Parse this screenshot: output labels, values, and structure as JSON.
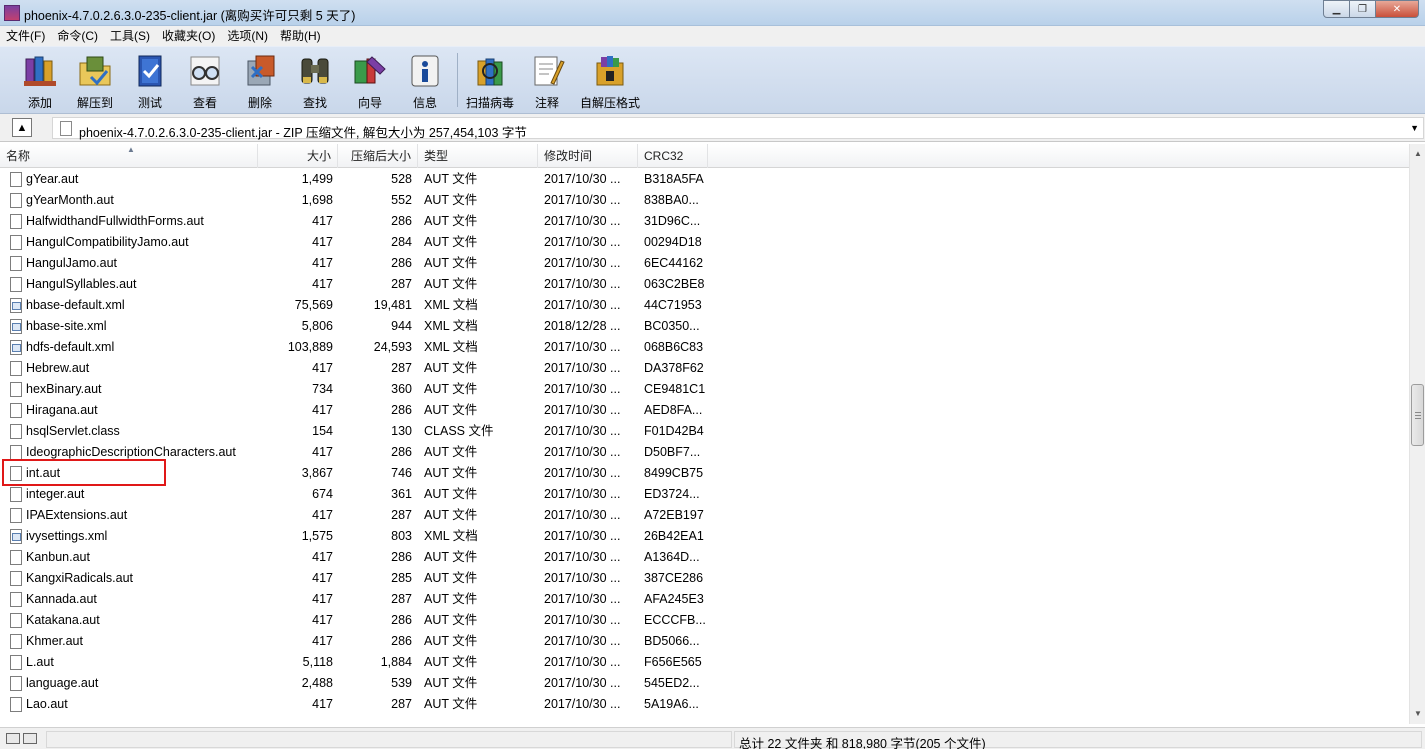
{
  "window": {
    "title": "phoenix-4.7.0.2.6.3.0-235-client.jar (离购买许可只剩 5 天了)",
    "min_glyph": "▁",
    "max_glyph": "❐",
    "close_glyph": "✕"
  },
  "menu": [
    {
      "label": "文件(F)"
    },
    {
      "label": "命令(C)"
    },
    {
      "label": "工具(S)"
    },
    {
      "label": "收藏夹(O)"
    },
    {
      "label": "选项(N)"
    },
    {
      "label": "帮助(H)"
    }
  ],
  "toolbar": [
    {
      "label": "添加",
      "icon": "add-books-icon"
    },
    {
      "label": "解压到",
      "icon": "extract-folder-icon"
    },
    {
      "label": "测试",
      "icon": "test-book-icon"
    },
    {
      "label": "查看",
      "icon": "view-glasses-icon"
    },
    {
      "label": "删除",
      "icon": "delete-icon"
    },
    {
      "label": "查找",
      "icon": "binoculars-icon"
    },
    {
      "label": "向导",
      "icon": "wizard-icon"
    },
    {
      "label": "信息",
      "icon": "info-icon"
    },
    {
      "label": "扫描病毒",
      "icon": "virus-scan-icon"
    },
    {
      "label": "注释",
      "icon": "comment-icon"
    },
    {
      "label": "自解压格式",
      "icon": "sfx-icon"
    }
  ],
  "address": {
    "up_glyph": "▲",
    "path": "phoenix-4.7.0.2.6.3.0-235-client.jar - ZIP 压缩文件, 解包大小为 257,454,103 字节",
    "dropdown_glyph": "▼"
  },
  "columns": {
    "name": "名称",
    "size": "大小",
    "packed": "压缩后大小",
    "type": "类型",
    "modified": "修改时间",
    "crc": "CRC32",
    "sort_glyph": "▲"
  },
  "files": [
    {
      "name": "gYear.aut",
      "size": "1,499",
      "packed": "528",
      "type": "AUT 文件",
      "modified": "2017/10/30 ...",
      "crc": "B318A5FA",
      "icon": "file-icon"
    },
    {
      "name": "gYearMonth.aut",
      "size": "1,698",
      "packed": "552",
      "type": "AUT 文件",
      "modified": "2017/10/30 ...",
      "crc": "838BA0...",
      "icon": "file-icon"
    },
    {
      "name": "HalfwidthandFullwidthForms.aut",
      "size": "417",
      "packed": "286",
      "type": "AUT 文件",
      "modified": "2017/10/30 ...",
      "crc": "31D96C...",
      "icon": "file-icon"
    },
    {
      "name": "HangulCompatibilityJamo.aut",
      "size": "417",
      "packed": "284",
      "type": "AUT 文件",
      "modified": "2017/10/30 ...",
      "crc": "00294D18",
      "icon": "file-icon"
    },
    {
      "name": "HangulJamo.aut",
      "size": "417",
      "packed": "286",
      "type": "AUT 文件",
      "modified": "2017/10/30 ...",
      "crc": "6EC44162",
      "icon": "file-icon"
    },
    {
      "name": "HangulSyllables.aut",
      "size": "417",
      "packed": "287",
      "type": "AUT 文件",
      "modified": "2017/10/30 ...",
      "crc": "063C2BE8",
      "icon": "file-icon"
    },
    {
      "name": "hbase-default.xml",
      "size": "75,569",
      "packed": "19,481",
      "type": "XML 文档",
      "modified": "2017/10/30 ...",
      "crc": "44C71953",
      "icon": "xml-file-icon"
    },
    {
      "name": "hbase-site.xml",
      "size": "5,806",
      "packed": "944",
      "type": "XML 文档",
      "modified": "2018/12/28 ...",
      "crc": "BC0350...",
      "icon": "xml-file-icon"
    },
    {
      "name": "hdfs-default.xml",
      "size": "103,889",
      "packed": "24,593",
      "type": "XML 文档",
      "modified": "2017/10/30 ...",
      "crc": "068B6C83",
      "icon": "xml-file-icon"
    },
    {
      "name": "Hebrew.aut",
      "size": "417",
      "packed": "287",
      "type": "AUT 文件",
      "modified": "2017/10/30 ...",
      "crc": "DA378F62",
      "icon": "file-icon"
    },
    {
      "name": "hexBinary.aut",
      "size": "734",
      "packed": "360",
      "type": "AUT 文件",
      "modified": "2017/10/30 ...",
      "crc": "CE9481C1",
      "icon": "file-icon"
    },
    {
      "name": "Hiragana.aut",
      "size": "417",
      "packed": "286",
      "type": "AUT 文件",
      "modified": "2017/10/30 ...",
      "crc": "AED8FA...",
      "icon": "file-icon"
    },
    {
      "name": "hsqlServlet.class",
      "size": "154",
      "packed": "130",
      "type": "CLASS 文件",
      "modified": "2017/10/30 ...",
      "crc": "F01D42B4",
      "icon": "file-icon"
    },
    {
      "name": "IdeographicDescriptionCharacters.aut",
      "size": "417",
      "packed": "286",
      "type": "AUT 文件",
      "modified": "2017/10/30 ...",
      "crc": "D50BF7...",
      "icon": "file-icon"
    },
    {
      "name": "int.aut",
      "size": "3,867",
      "packed": "746",
      "type": "AUT 文件",
      "modified": "2017/10/30 ...",
      "crc": "8499CB75",
      "icon": "file-icon"
    },
    {
      "name": "integer.aut",
      "size": "674",
      "packed": "361",
      "type": "AUT 文件",
      "modified": "2017/10/30 ...",
      "crc": "ED3724...",
      "icon": "file-icon"
    },
    {
      "name": "IPAExtensions.aut",
      "size": "417",
      "packed": "287",
      "type": "AUT 文件",
      "modified": "2017/10/30 ...",
      "crc": "A72EB197",
      "icon": "file-icon"
    },
    {
      "name": "ivysettings.xml",
      "size": "1,575",
      "packed": "803",
      "type": "XML 文档",
      "modified": "2017/10/30 ...",
      "crc": "26B42EA1",
      "icon": "xml-file-icon"
    },
    {
      "name": "Kanbun.aut",
      "size": "417",
      "packed": "286",
      "type": "AUT 文件",
      "modified": "2017/10/30 ...",
      "crc": "A1364D...",
      "icon": "file-icon"
    },
    {
      "name": "KangxiRadicals.aut",
      "size": "417",
      "packed": "285",
      "type": "AUT 文件",
      "modified": "2017/10/30 ...",
      "crc": "387CE286",
      "icon": "file-icon"
    },
    {
      "name": "Kannada.aut",
      "size": "417",
      "packed": "287",
      "type": "AUT 文件",
      "modified": "2017/10/30 ...",
      "crc": "AFA245E3",
      "icon": "file-icon"
    },
    {
      "name": "Katakana.aut",
      "size": "417",
      "packed": "286",
      "type": "AUT 文件",
      "modified": "2017/10/30 ...",
      "crc": "ECCCFB...",
      "icon": "file-icon"
    },
    {
      "name": "Khmer.aut",
      "size": "417",
      "packed": "286",
      "type": "AUT 文件",
      "modified": "2017/10/30 ...",
      "crc": "BD5066...",
      "icon": "file-icon"
    },
    {
      "name": "L.aut",
      "size": "5,118",
      "packed": "1,884",
      "type": "AUT 文件",
      "modified": "2017/10/30 ...",
      "crc": "F656E565",
      "icon": "file-icon"
    },
    {
      "name": "language.aut",
      "size": "2,488",
      "packed": "539",
      "type": "AUT 文件",
      "modified": "2017/10/30 ...",
      "crc": "545ED2...",
      "icon": "file-icon"
    },
    {
      "name": "Lao.aut",
      "size": "417",
      "packed": "287",
      "type": "AUT 文件",
      "modified": "2017/10/30 ...",
      "crc": "5A19A6...",
      "icon": "file-icon"
    }
  ],
  "highlighted_file": "hbase-site.xml",
  "scrollbar": {
    "up_glyph": "▲",
    "down_glyph": "▼"
  },
  "status": {
    "left": "",
    "right": "总计 22 文件夹 和 818,980 字节(205 个文件)"
  },
  "colors": {
    "highlight": "#e01818",
    "toolbar_bg": "#d2dfef"
  }
}
